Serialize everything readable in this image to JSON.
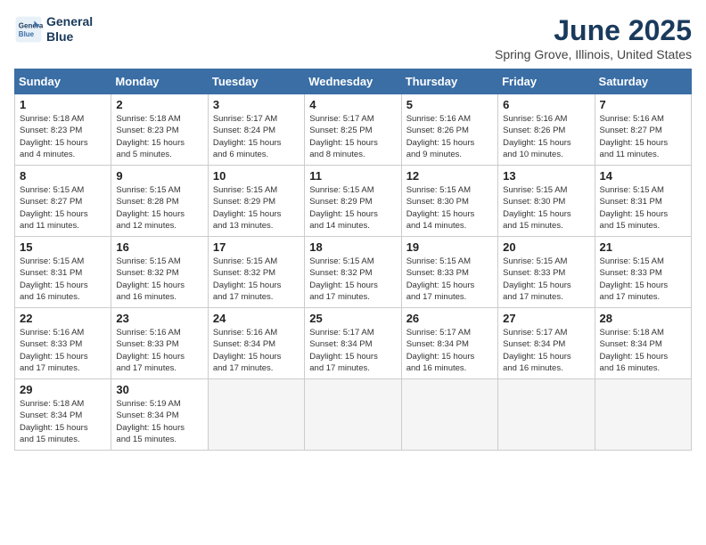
{
  "header": {
    "logo_line1": "General",
    "logo_line2": "Blue",
    "title": "June 2025",
    "subtitle": "Spring Grove, Illinois, United States"
  },
  "days_of_week": [
    "Sunday",
    "Monday",
    "Tuesday",
    "Wednesday",
    "Thursday",
    "Friday",
    "Saturday"
  ],
  "weeks": [
    [
      {
        "day": "1",
        "info": "Sunrise: 5:18 AM\nSunset: 8:23 PM\nDaylight: 15 hours\nand 4 minutes."
      },
      {
        "day": "2",
        "info": "Sunrise: 5:18 AM\nSunset: 8:23 PM\nDaylight: 15 hours\nand 5 minutes."
      },
      {
        "day": "3",
        "info": "Sunrise: 5:17 AM\nSunset: 8:24 PM\nDaylight: 15 hours\nand 6 minutes."
      },
      {
        "day": "4",
        "info": "Sunrise: 5:17 AM\nSunset: 8:25 PM\nDaylight: 15 hours\nand 8 minutes."
      },
      {
        "day": "5",
        "info": "Sunrise: 5:16 AM\nSunset: 8:26 PM\nDaylight: 15 hours\nand 9 minutes."
      },
      {
        "day": "6",
        "info": "Sunrise: 5:16 AM\nSunset: 8:26 PM\nDaylight: 15 hours\nand 10 minutes."
      },
      {
        "day": "7",
        "info": "Sunrise: 5:16 AM\nSunset: 8:27 PM\nDaylight: 15 hours\nand 11 minutes."
      }
    ],
    [
      {
        "day": "8",
        "info": "Sunrise: 5:15 AM\nSunset: 8:27 PM\nDaylight: 15 hours\nand 11 minutes."
      },
      {
        "day": "9",
        "info": "Sunrise: 5:15 AM\nSunset: 8:28 PM\nDaylight: 15 hours\nand 12 minutes."
      },
      {
        "day": "10",
        "info": "Sunrise: 5:15 AM\nSunset: 8:29 PM\nDaylight: 15 hours\nand 13 minutes."
      },
      {
        "day": "11",
        "info": "Sunrise: 5:15 AM\nSunset: 8:29 PM\nDaylight: 15 hours\nand 14 minutes."
      },
      {
        "day": "12",
        "info": "Sunrise: 5:15 AM\nSunset: 8:30 PM\nDaylight: 15 hours\nand 14 minutes."
      },
      {
        "day": "13",
        "info": "Sunrise: 5:15 AM\nSunset: 8:30 PM\nDaylight: 15 hours\nand 15 minutes."
      },
      {
        "day": "14",
        "info": "Sunrise: 5:15 AM\nSunset: 8:31 PM\nDaylight: 15 hours\nand 15 minutes."
      }
    ],
    [
      {
        "day": "15",
        "info": "Sunrise: 5:15 AM\nSunset: 8:31 PM\nDaylight: 15 hours\nand 16 minutes."
      },
      {
        "day": "16",
        "info": "Sunrise: 5:15 AM\nSunset: 8:32 PM\nDaylight: 15 hours\nand 16 minutes."
      },
      {
        "day": "17",
        "info": "Sunrise: 5:15 AM\nSunset: 8:32 PM\nDaylight: 15 hours\nand 17 minutes."
      },
      {
        "day": "18",
        "info": "Sunrise: 5:15 AM\nSunset: 8:32 PM\nDaylight: 15 hours\nand 17 minutes."
      },
      {
        "day": "19",
        "info": "Sunrise: 5:15 AM\nSunset: 8:33 PM\nDaylight: 15 hours\nand 17 minutes."
      },
      {
        "day": "20",
        "info": "Sunrise: 5:15 AM\nSunset: 8:33 PM\nDaylight: 15 hours\nand 17 minutes."
      },
      {
        "day": "21",
        "info": "Sunrise: 5:15 AM\nSunset: 8:33 PM\nDaylight: 15 hours\nand 17 minutes."
      }
    ],
    [
      {
        "day": "22",
        "info": "Sunrise: 5:16 AM\nSunset: 8:33 PM\nDaylight: 15 hours\nand 17 minutes."
      },
      {
        "day": "23",
        "info": "Sunrise: 5:16 AM\nSunset: 8:33 PM\nDaylight: 15 hours\nand 17 minutes."
      },
      {
        "day": "24",
        "info": "Sunrise: 5:16 AM\nSunset: 8:34 PM\nDaylight: 15 hours\nand 17 minutes."
      },
      {
        "day": "25",
        "info": "Sunrise: 5:17 AM\nSunset: 8:34 PM\nDaylight: 15 hours\nand 17 minutes."
      },
      {
        "day": "26",
        "info": "Sunrise: 5:17 AM\nSunset: 8:34 PM\nDaylight: 15 hours\nand 16 minutes."
      },
      {
        "day": "27",
        "info": "Sunrise: 5:17 AM\nSunset: 8:34 PM\nDaylight: 15 hours\nand 16 minutes."
      },
      {
        "day": "28",
        "info": "Sunrise: 5:18 AM\nSunset: 8:34 PM\nDaylight: 15 hours\nand 16 minutes."
      }
    ],
    [
      {
        "day": "29",
        "info": "Sunrise: 5:18 AM\nSunset: 8:34 PM\nDaylight: 15 hours\nand 15 minutes."
      },
      {
        "day": "30",
        "info": "Sunrise: 5:19 AM\nSunset: 8:34 PM\nDaylight: 15 hours\nand 15 minutes."
      },
      {
        "day": "",
        "info": ""
      },
      {
        "day": "",
        "info": ""
      },
      {
        "day": "",
        "info": ""
      },
      {
        "day": "",
        "info": ""
      },
      {
        "day": "",
        "info": ""
      }
    ]
  ]
}
